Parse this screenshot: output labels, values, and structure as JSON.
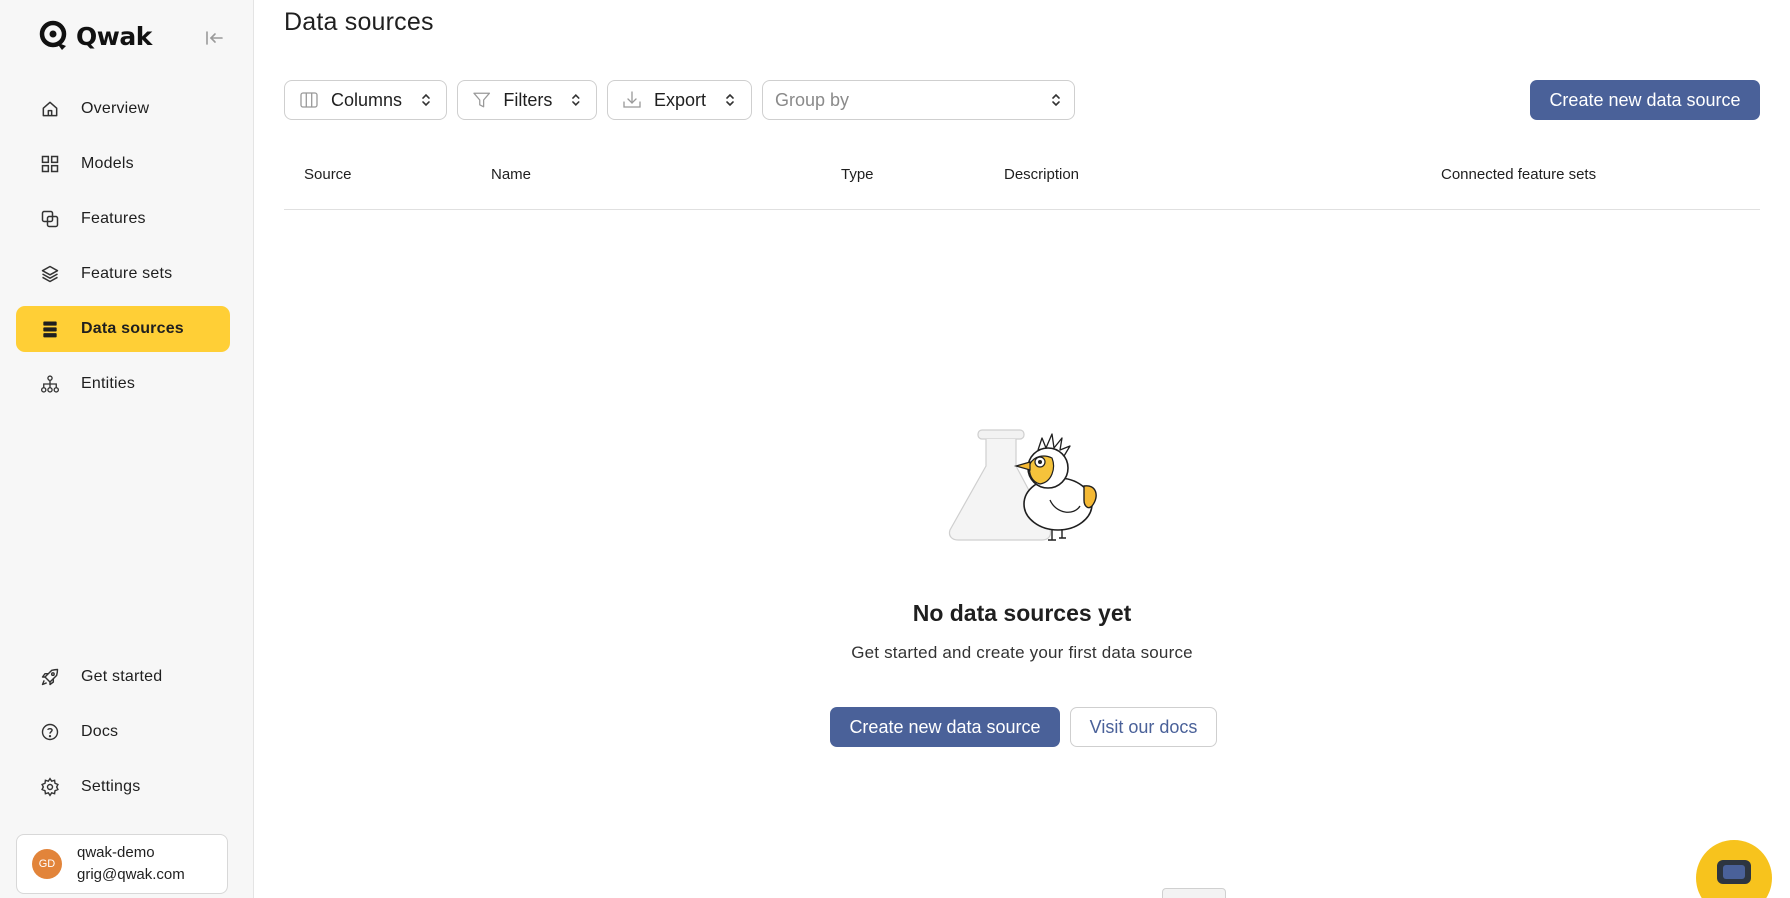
{
  "app": {
    "logo_text": "Qwak"
  },
  "sidebar": {
    "items": [
      {
        "label": "Overview",
        "icon": "home-icon",
        "active": false
      },
      {
        "label": "Models",
        "icon": "grid-icon",
        "active": false
      },
      {
        "label": "Features",
        "icon": "features-icon",
        "active": false
      },
      {
        "label": "Feature sets",
        "icon": "layers-icon",
        "active": false
      },
      {
        "label": "Data sources",
        "icon": "database-icon",
        "active": true
      },
      {
        "label": "Entities",
        "icon": "hierarchy-icon",
        "active": false
      }
    ],
    "bottom_items": [
      {
        "label": "Get started",
        "icon": "rocket-icon"
      },
      {
        "label": "Docs",
        "icon": "help-circle-icon"
      },
      {
        "label": "Settings",
        "icon": "gear-icon"
      }
    ],
    "user": {
      "initials": "GD",
      "name": "qwak-demo",
      "email": "grig@qwak.com"
    }
  },
  "main": {
    "title": "Data sources",
    "toolbar": {
      "columns_label": "Columns",
      "filters_label": "Filters",
      "export_label": "Export",
      "groupby_placeholder": "Group by",
      "create_label": "Create new data source"
    },
    "table": {
      "columns": [
        "Source",
        "Name",
        "Type",
        "Description",
        "Connected feature sets"
      ]
    },
    "empty_state": {
      "title": "No data sources yet",
      "subtitle": "Get started and create your first data source",
      "create_label": "Create new data source",
      "docs_label": "Visit our docs"
    }
  },
  "colors": {
    "accent": "#ffcf36",
    "primary_button": "#4a6199",
    "chat_bubble": "#f7c31d",
    "avatar": "#e2843a"
  }
}
